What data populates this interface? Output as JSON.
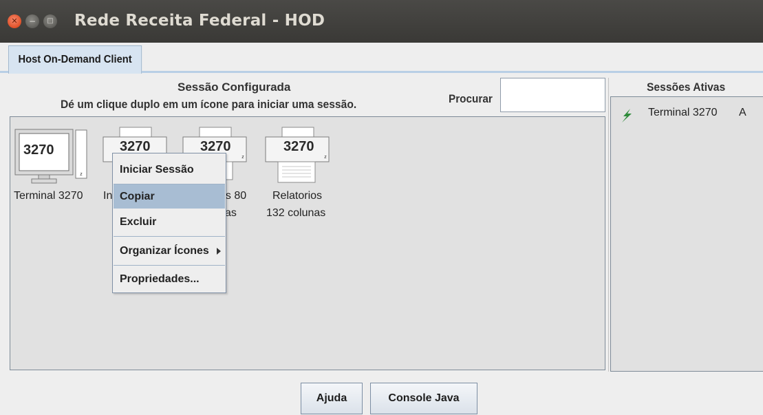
{
  "window": {
    "title": "Rede Receita Federal - HOD"
  },
  "tabs": [
    {
      "label": "Host On-Demand Client"
    }
  ],
  "configured": {
    "heading": "Sessão Configurada",
    "instruction": "Dé um clique duplo em um ícone para iniciar uma sessão.",
    "search_label": "Procurar",
    "search_value": "",
    "sessions": [
      {
        "badge": "3270",
        "label_line1": "Terminal 3270",
        "label_line2": ""
      },
      {
        "badge": "3270",
        "label_line1": "In",
        "label_line2": ""
      },
      {
        "badge": "3270",
        "label_line1": "os 80",
        "label_line2": "as"
      },
      {
        "badge": "3270",
        "label_line1": "Relatorios",
        "label_line2": "132 colunas"
      }
    ]
  },
  "active": {
    "heading": "Sessões Ativas",
    "items": [
      {
        "name": "Terminal 3270",
        "short": "A",
        "icon": "lightning-icon",
        "icon_color": "#2e8b3a"
      }
    ]
  },
  "context_menu": {
    "items": [
      {
        "label": "Iniciar Sessão",
        "selected": false
      },
      {
        "label": "Copiar",
        "selected": true
      },
      {
        "label": "Excluir",
        "selected": false
      },
      {
        "label": "Organizar Ícones",
        "selected": false,
        "submenu": true
      },
      {
        "label": "Propriedades...",
        "selected": false
      }
    ]
  },
  "buttons": {
    "help": "Ajuda",
    "console": "Console Java"
  },
  "colors": {
    "menu_highlight": "#a8bdd3",
    "close_button": "#e2542c"
  }
}
